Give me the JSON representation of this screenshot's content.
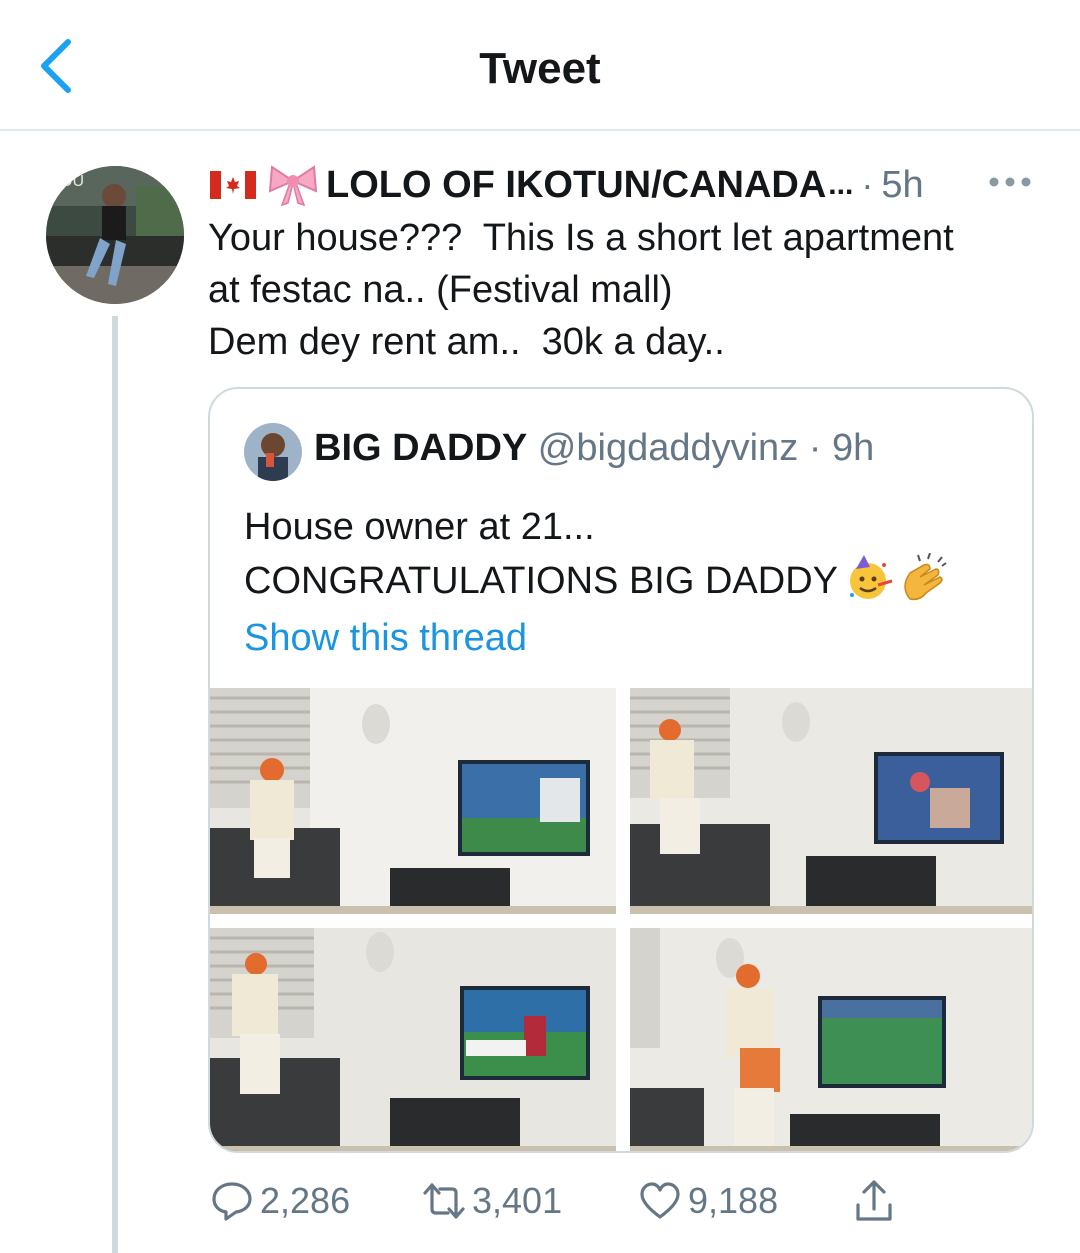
{
  "header": {
    "title": "Tweet"
  },
  "tweet": {
    "author_name": "LOLO OF IKOTUN/CANADA",
    "truncation": "...",
    "time": "5h",
    "lines": [
      "Your house???  This Is a short let apartment",
      "at festac na.. (Festival mall)",
      "Dem dey rent am..  30k a day.."
    ]
  },
  "quote": {
    "name": "BIG DADDY",
    "handle": "@bigdaddyvinz",
    "time": "9h",
    "line1": "House owner at 21...",
    "line2": "CONGRATULATIONS BIG DADDY",
    "show_thread": "Show this thread"
  },
  "actions": {
    "replies": "2,286",
    "retweets": "3,401",
    "likes": "9,188"
  },
  "colors": {
    "link": "#1b95e0",
    "secondary": "#657786",
    "border": "#cfd9de"
  }
}
